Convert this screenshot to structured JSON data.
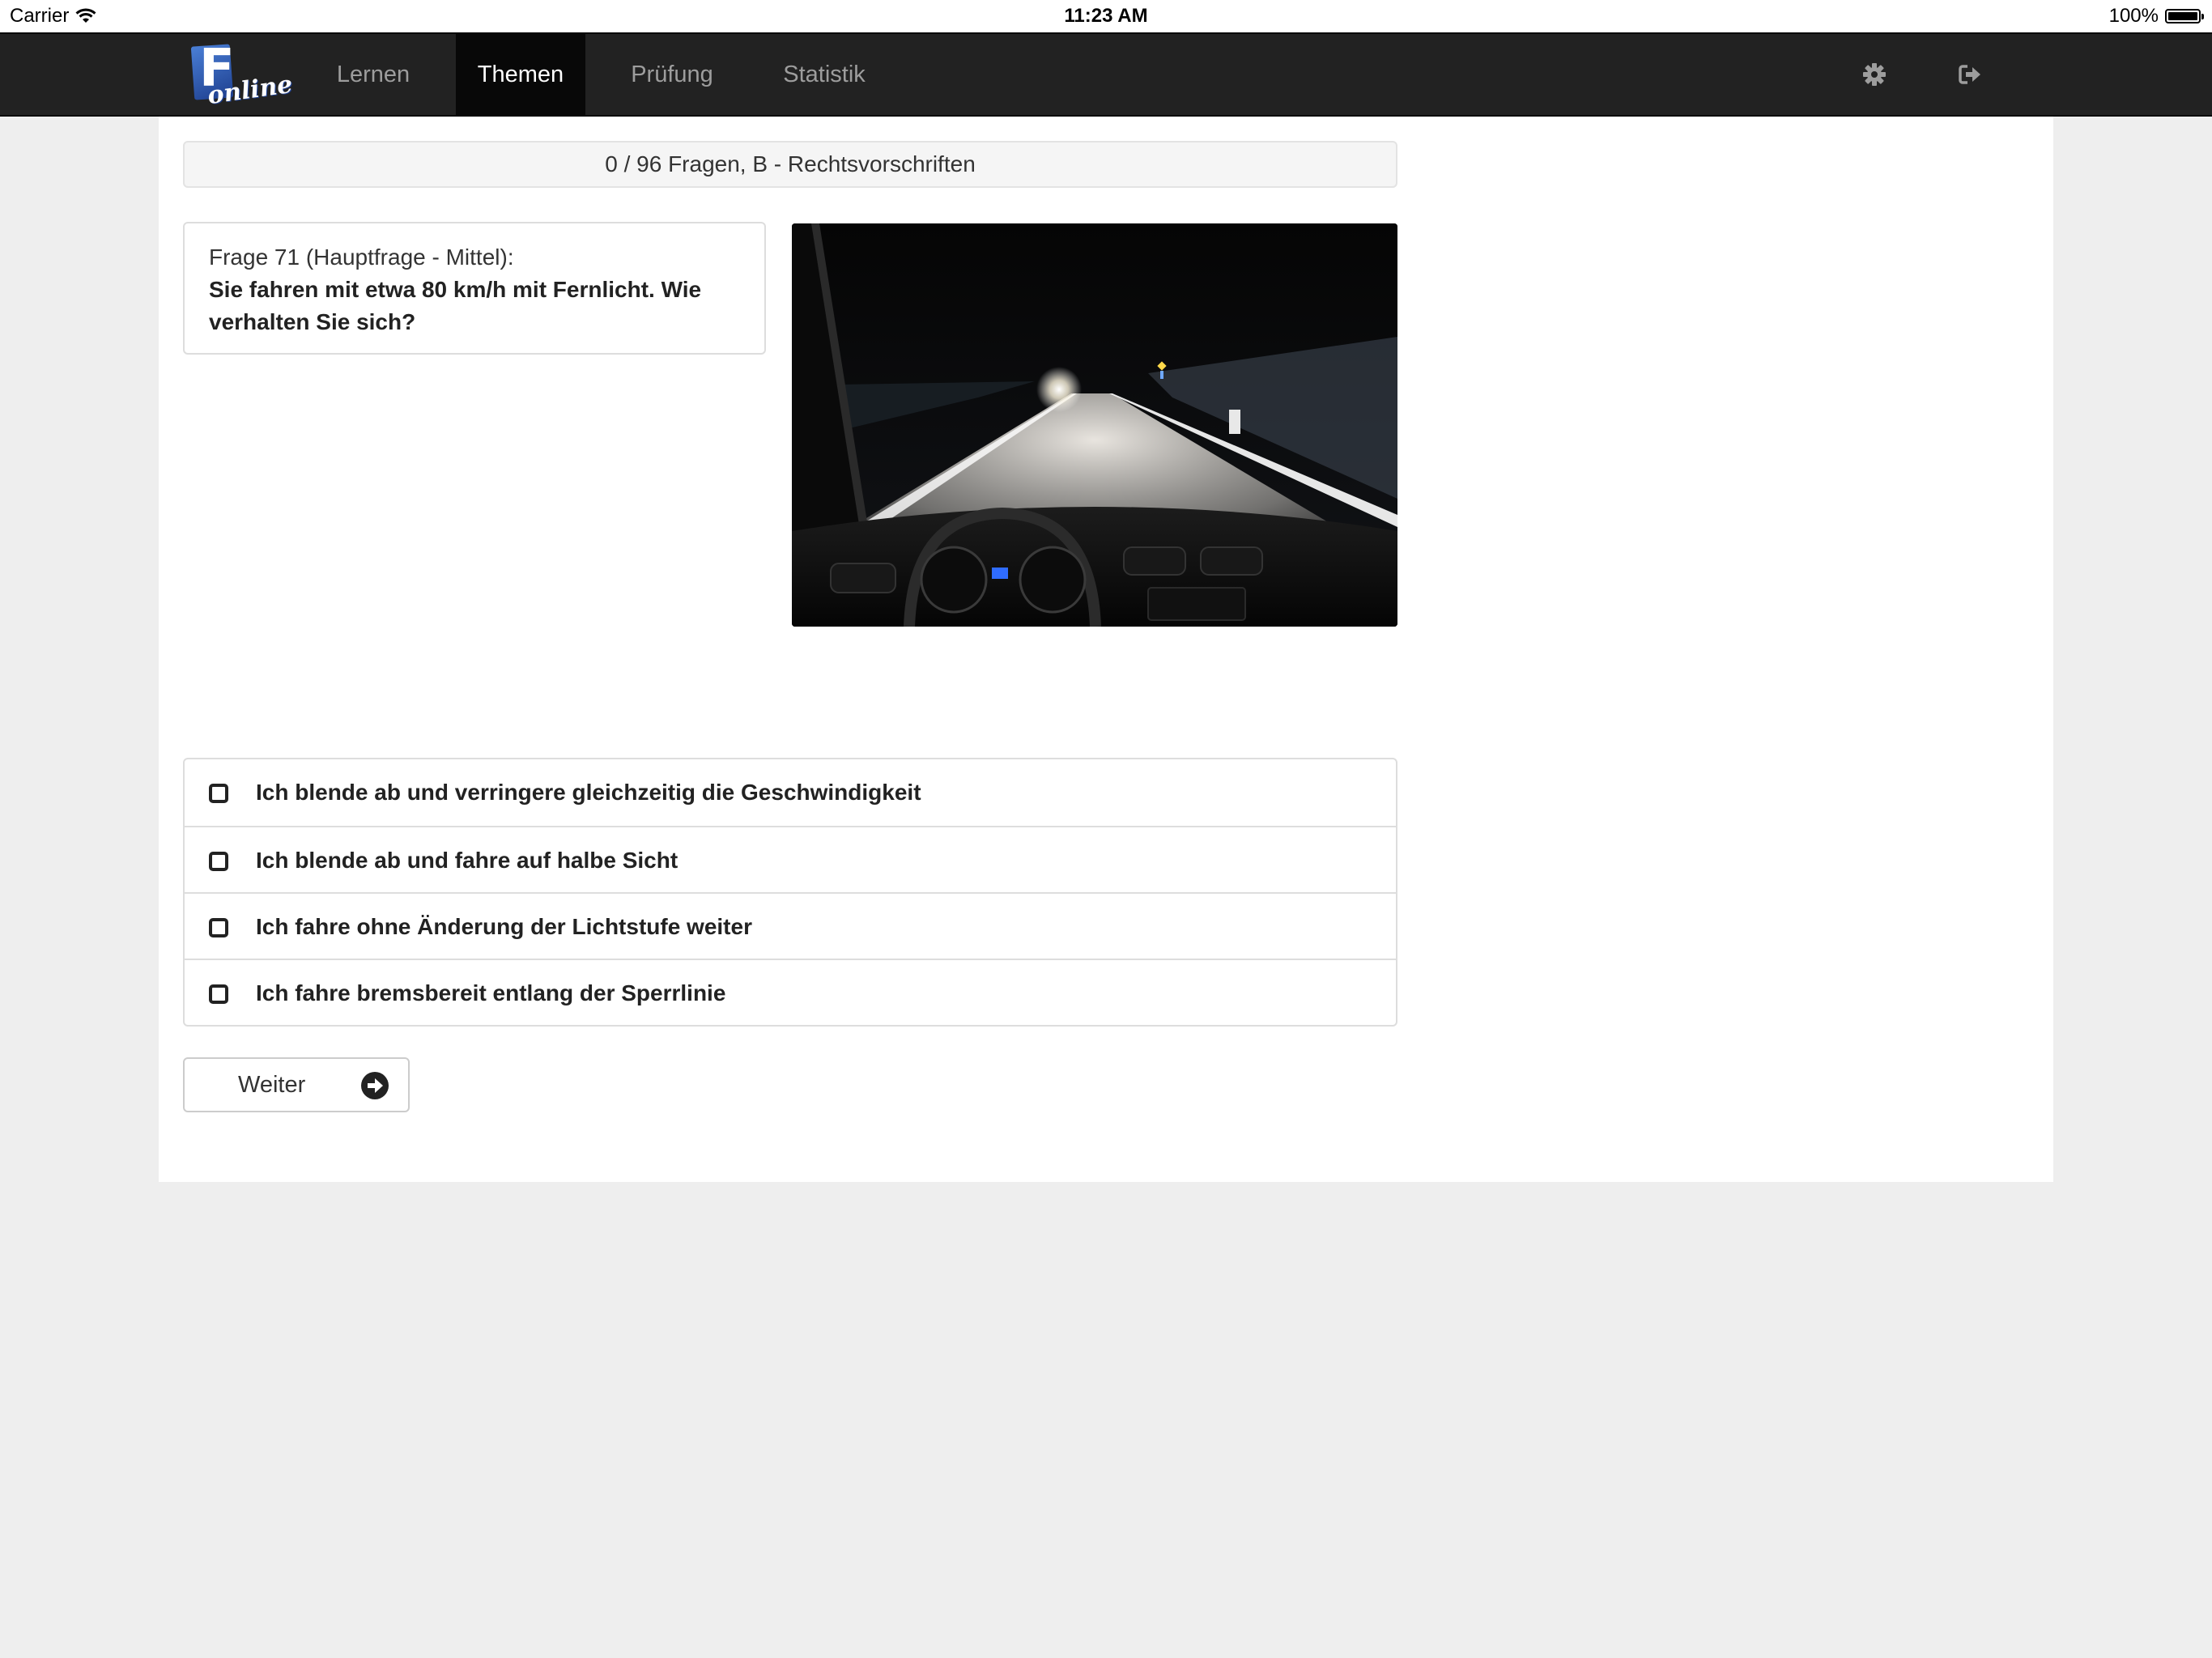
{
  "status_bar": {
    "carrier": "Carrier",
    "time": "11:23 AM",
    "battery": "100%"
  },
  "navbar": {
    "logo_letter": "F",
    "logo_word": "online",
    "tabs": [
      {
        "label": "Lernen",
        "active": false
      },
      {
        "label": "Themen",
        "active": true
      },
      {
        "label": "Prüfung",
        "active": false
      },
      {
        "label": "Statistik",
        "active": false
      }
    ],
    "icons": [
      "gear-icon",
      "logout-icon"
    ]
  },
  "main": {
    "progress": "0 / 96 Fragen, B - Rechtsvorschriften",
    "question": {
      "meta": "Frage 71 (Hauptfrage - Mittel):",
      "text": "Sie fahren mit etwa 80 km/h mit Fernlicht. Wie verhalten Sie sich?"
    },
    "answers": [
      {
        "label": "Ich blende ab und verringere gleichzeitig die Geschwindigkeit",
        "checked": false
      },
      {
        "label": "Ich blende ab und fahre auf halbe Sicht",
        "checked": false
      },
      {
        "label": "Ich fahre ohne Änderung der Lichtstufe weiter",
        "checked": false
      },
      {
        "label": "Ich fahre bremsbereit entlang der Sperrlinie",
        "checked": false
      }
    ],
    "next_button": "Weiter"
  },
  "colors": {
    "navbar_bg": "#222222",
    "navbar_active": "#080808",
    "page_bg": "#eeeeee",
    "logo_blue": "#2c55b0"
  }
}
